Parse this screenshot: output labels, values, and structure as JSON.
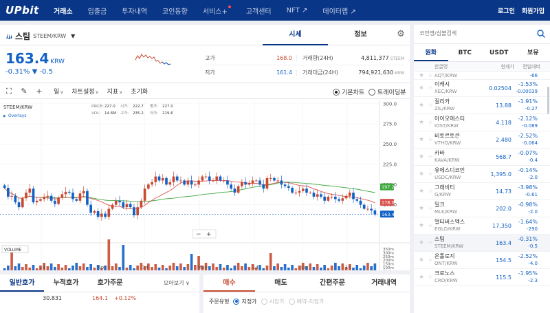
{
  "nav": {
    "logo": "UPbit",
    "items": [
      "거래소",
      "입출금",
      "투자내역",
      "코인동향",
      "서비스+",
      "고객센터",
      "NFT ↗",
      "데이터랩 ↗"
    ],
    "login": "로그인",
    "signup": "회원가입"
  },
  "coin": {
    "name": "스팀",
    "pair": "STEEM/KRW",
    "price": "163.4",
    "unit": "KRW",
    "change_pct": "-0.31%",
    "change_abs": "▼ -0.5",
    "tabs": [
      "시세",
      "정보"
    ]
  },
  "stats": {
    "high_label": "고가",
    "high": "168.0",
    "low_label": "저가",
    "low": "161.4",
    "vol_label": "거래량(24H)",
    "vol": "4,811,377",
    "vol_unit": "STEEM",
    "amt_label": "거래대금(24H)",
    "amt": "794,921,630",
    "amt_unit": "KRW"
  },
  "toolbar": {
    "period": "일",
    "settings": "차트설정",
    "indicator": "지표",
    "reset": "초기화",
    "basic": "기본차트",
    "tradingview": "트레이딩뷰"
  },
  "chart_data": {
    "type": "candlestick",
    "symbol": "STEEM/KRW",
    "ohlc_info": {
      "price": "227.0",
      "open": "222.7",
      "high": "227.0",
      "vol": "14.6M",
      "high2": "235.2",
      "low": "219.6",
      "labels": {
        "price": "PRICE:",
        "open": "시가:",
        "close": "종가:",
        "vol": "VOL:",
        "high": "고가:",
        "low": "저가:"
      }
    },
    "overlays_label": "Overlays",
    "volume_label": "VOLUME",
    "y_ticks": [
      300,
      275,
      250,
      225,
      200,
      175
    ],
    "vol_ticks": [
      "350m",
      "300m",
      "250m",
      "200m",
      "150m",
      "100m",
      "50.0m"
    ],
    "x_labels": [
      "14",
      "Apr",
      "14",
      "May",
      "14",
      "Jun",
      "14"
    ],
    "ma_labels": [
      "197.2",
      "178.0",
      "163.4"
    ],
    "ylim": [
      150,
      305
    ],
    "closes": [
      196,
      185,
      186,
      178,
      172,
      183,
      190,
      195,
      178,
      180,
      182,
      185,
      186,
      180,
      176,
      184,
      188,
      191,
      190,
      182,
      180,
      189,
      192,
      175,
      165,
      167,
      160,
      164,
      160,
      170,
      175,
      180,
      178,
      172,
      176,
      172,
      162,
      172,
      180,
      195,
      200,
      203,
      210,
      205,
      208,
      200,
      203,
      210,
      205,
      205,
      200,
      205,
      200,
      200,
      205,
      210,
      210,
      205,
      205,
      210,
      205,
      205,
      200,
      195,
      190,
      198,
      203,
      200,
      202,
      205,
      205,
      200,
      195,
      208,
      208,
      205,
      205,
      200,
      198,
      196,
      190,
      190,
      192,
      195,
      190,
      190,
      185,
      188,
      185,
      180,
      185,
      185,
      182,
      180,
      183,
      186,
      190,
      182,
      180,
      175,
      170,
      170,
      168,
      163
    ]
  },
  "order_book": {
    "tabs": [
      "일반호가",
      "누적호가",
      "호가주문"
    ],
    "select": "모아보기",
    "row_qty": "30.831",
    "row_price": "164.1",
    "row_pct": "+0.12%"
  },
  "order": {
    "tabs": [
      "매수",
      "매도",
      "간편주문",
      "거래내역"
    ],
    "type_label": "주문유형",
    "options": [
      "지정가",
      "시장가",
      "예약-지정가"
    ]
  },
  "sidebar": {
    "search_placeholder": "코인명/심볼검색",
    "tabs": [
      "원화",
      "BTC",
      "USDT",
      "보유"
    ],
    "headers": [
      "한글명",
      "현재가",
      "전일대비"
    ],
    "coins": [
      {
        "name": "",
        "sym": "AQT/KRW",
        "price": "",
        "pct": "",
        "abs": "-66",
        "dir": "down"
      },
      {
        "name": "이캐시",
        "sym": "XEC/KRW",
        "price": "0.02504",
        "pct": "-1.53%",
        "abs": "-0.00039",
        "dir": "down"
      },
      {
        "name": "질리카",
        "sym": "ZIL/KRW",
        "price": "13.88",
        "pct": "-1.91%",
        "abs": "-0.27",
        "dir": "down"
      },
      {
        "name": "아이오에스티",
        "sym": "IOST/KRW",
        "price": "4.118",
        "pct": "-2.12%",
        "abs": "-0.089",
        "dir": "down"
      },
      {
        "name": "비토르토큰",
        "sym": "VTHO/KRW",
        "price": "2.480",
        "pct": "-2.52%",
        "abs": "-0.064",
        "dir": "down"
      },
      {
        "name": "카바",
        "sym": "KAVA/KRW",
        "price": "568.7",
        "pct": "-0.07%",
        "abs": "-0.4",
        "dir": "down"
      },
      {
        "name": "유에스디코인",
        "sym": "USDC/KRW",
        "price": "1,395.0",
        "pct": "-0.14%",
        "abs": "-2.0",
        "dir": "down"
      },
      {
        "name": "그래비티",
        "sym": "G/KRW",
        "price": "14.73",
        "pct": "-3.98%",
        "abs": "-0.61",
        "dir": "down"
      },
      {
        "name": "밀크",
        "sym": "MLK/KRW",
        "price": "202.0",
        "pct": "-0.98%",
        "abs": "-2.0",
        "dir": "down"
      },
      {
        "name": "멀티버스엑스",
        "sym": "EGLD/KRW",
        "price": "17,350",
        "pct": "-1.64%",
        "abs": "-290",
        "dir": "down"
      },
      {
        "name": "스팀",
        "sym": "STEEM/KRW",
        "price": "163.4",
        "pct": "-0.31%",
        "abs": "-0.5",
        "dir": "down",
        "selected": true
      },
      {
        "name": "온톨로지",
        "sym": "ONT/KRW",
        "price": "154.5",
        "pct": "-2.52%",
        "abs": "-4.0",
        "dir": "down"
      },
      {
        "name": "크로노스",
        "sym": "CRO/KRW",
        "price": "115.5",
        "pct": "-1.95%",
        "abs": "-2.3",
        "dir": "down"
      }
    ]
  },
  "colors": {
    "nav": "#093687",
    "up": "#c84a31",
    "down": "#1261c4",
    "ma_green": "#3fa83f",
    "ma_red": "#d9534f"
  }
}
